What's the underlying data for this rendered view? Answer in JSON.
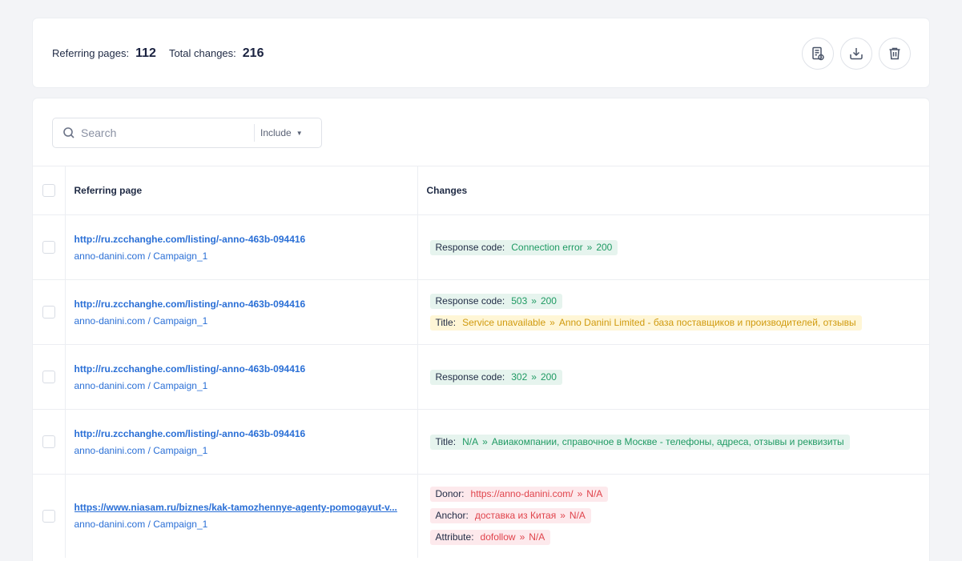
{
  "stats": {
    "referring_label": "Referring pages:",
    "referring_value": "112",
    "changes_label": "Total changes:",
    "changes_value": "216"
  },
  "actions": [
    {
      "icon": "report-icon"
    },
    {
      "icon": "download-icon"
    },
    {
      "icon": "trash-icon"
    }
  ],
  "search": {
    "placeholder": "Search",
    "filter_label": "Include"
  },
  "table": {
    "columns": [
      "Referring page",
      "Changes"
    ],
    "rows": [
      {
        "url": "http://ru.zcchanghe.com/listing/-anno-463b-094416",
        "domain": "anno-danini.com",
        "campaign": "Campaign_1",
        "changes": [
          {
            "label": "Response code:",
            "from": "Connection error",
            "to": "200",
            "color": "green"
          }
        ]
      },
      {
        "url": "http://ru.zcchanghe.com/listing/-anno-463b-094416",
        "domain": "anno-danini.com",
        "campaign": "Campaign_1",
        "changes": [
          {
            "label": "Response code:",
            "from": "503",
            "to": "200",
            "color": "green"
          },
          {
            "label": "Title:",
            "from": "Service unavailable",
            "to": "Anno Danini Limited - база поставщиков и производителей, отзывы",
            "color": "yellow"
          }
        ]
      },
      {
        "url": "http://ru.zcchanghe.com/listing/-anno-463b-094416",
        "domain": "anno-danini.com",
        "campaign": "Campaign_1",
        "changes": [
          {
            "label": "Response code:",
            "from": "302",
            "to": "200",
            "color": "green"
          }
        ]
      },
      {
        "url": "http://ru.zcchanghe.com/listing/-anno-463b-094416",
        "domain": "anno-danini.com",
        "campaign": "Campaign_1",
        "changes": [
          {
            "label": "Title:",
            "from": "N/A",
            "to": "Авиакомпании, справочное в Москве - телефоны, адреса, отзывы и реквизиты",
            "color": "green"
          }
        ]
      },
      {
        "url": "https://www.niasam.ru/biznes/kak-tamozhennye-agenty-pomogayut-v...",
        "domain": "anno-danini.com",
        "campaign": "Campaign_1",
        "changes": [
          {
            "label": "Donor:",
            "from": "https://anno-danini.com/",
            "to": "N/A",
            "color": "red"
          },
          {
            "label": "Anchor:",
            "from": "доставка из Китая",
            "to": "N/A",
            "color": "red"
          },
          {
            "label": "Attribute:",
            "from": "dofollow",
            "to": "N/A",
            "color": "red"
          }
        ]
      }
    ]
  }
}
